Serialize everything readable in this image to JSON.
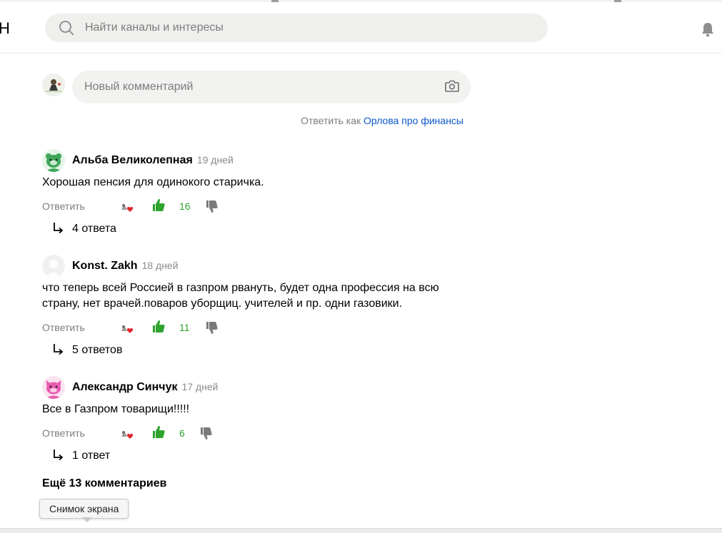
{
  "header": {
    "logo_fragment": "Н",
    "search_placeholder": "Найти каналы и интересы",
    "icons": {
      "search": "search-icon",
      "bell": "bell-icon"
    }
  },
  "composer": {
    "placeholder": "Новый комментарий",
    "reply_as_prefix": "Ответить как",
    "reply_as_name": "Орлова про финансы",
    "icons": {
      "camera": "camera-icon"
    }
  },
  "comments": [
    {
      "author": "Альба Великолепная",
      "time": "19 дней",
      "text": "Хорошая пенсия для одинокого старичка.",
      "reply_label": "Ответить",
      "likes": "16",
      "replies": "4 ответа",
      "avatar": "green-bear-avatar"
    },
    {
      "author": "Konst. Zakh",
      "time": "18 дней",
      "text": "что теперь всей Россией в газпром рвануть, будет одна профессия на всю страну, нет врачей.поваров уборщиц. учителей и пр. одни газовики.",
      "reply_label": "Ответить",
      "likes": "11",
      "replies": "5 ответов",
      "avatar": "default-avatar"
    },
    {
      "author": "Александр Синчук",
      "time": "17 дней",
      "text": "Все в Газпром товарищи!!!!!",
      "reply_label": "Ответить",
      "likes": "6",
      "replies": "1 ответ",
      "avatar": "pink-cat-avatar"
    }
  ],
  "more_comments": "Ещё 13 комментариев",
  "tooltip": "Снимок экрана",
  "colors": {
    "like_green": "#2ea42e",
    "link_blue": "#0b57c7",
    "muted": "#7c7c7c",
    "field_bg": "#f2f2f0"
  }
}
